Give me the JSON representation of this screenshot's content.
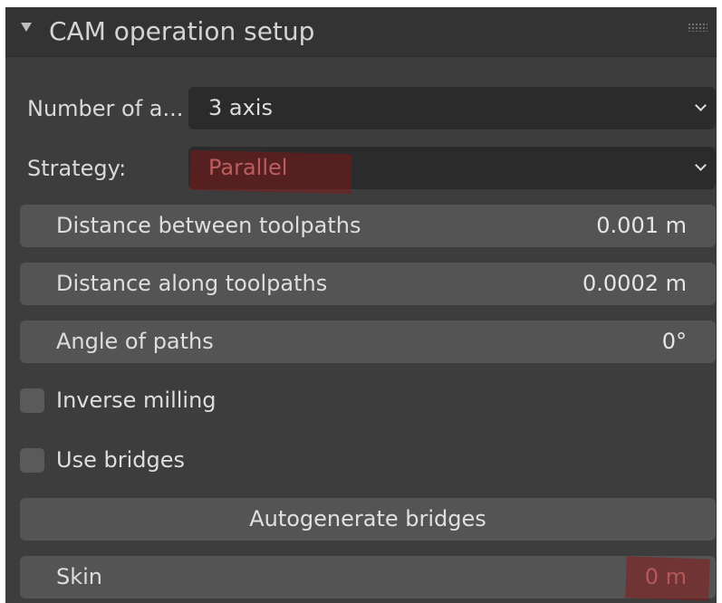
{
  "panel": {
    "title": "CAM operation setup",
    "collapse_icon": "triangle-down-icon",
    "drag_icon": "drag-handle-icon"
  },
  "axes": {
    "label": "Number of a...",
    "value": "3 axis"
  },
  "strategy": {
    "label": "Strategy:",
    "value": "Parallel"
  },
  "fields": {
    "distance_between": {
      "label": "Distance between toolpaths",
      "value": "0.001 m"
    },
    "distance_along": {
      "label": "Distance along toolpaths",
      "value": "0.0002 m"
    },
    "angle": {
      "label": "Angle of paths",
      "value": "0°"
    }
  },
  "checkboxes": {
    "inverse_milling": {
      "label": "Inverse milling",
      "checked": false
    },
    "use_bridges": {
      "label": "Use bridges",
      "checked": false
    }
  },
  "autogenerate": {
    "label": "Autogenerate bridges"
  },
  "skin": {
    "label": "Skin",
    "value": "0 m"
  },
  "colors": {
    "panel_bg": "#3d3d3d",
    "header_bg": "#333333",
    "field_bg": "#545454",
    "dropdown_bg": "#2b2b2b",
    "highlight_red": "#8c1414"
  }
}
